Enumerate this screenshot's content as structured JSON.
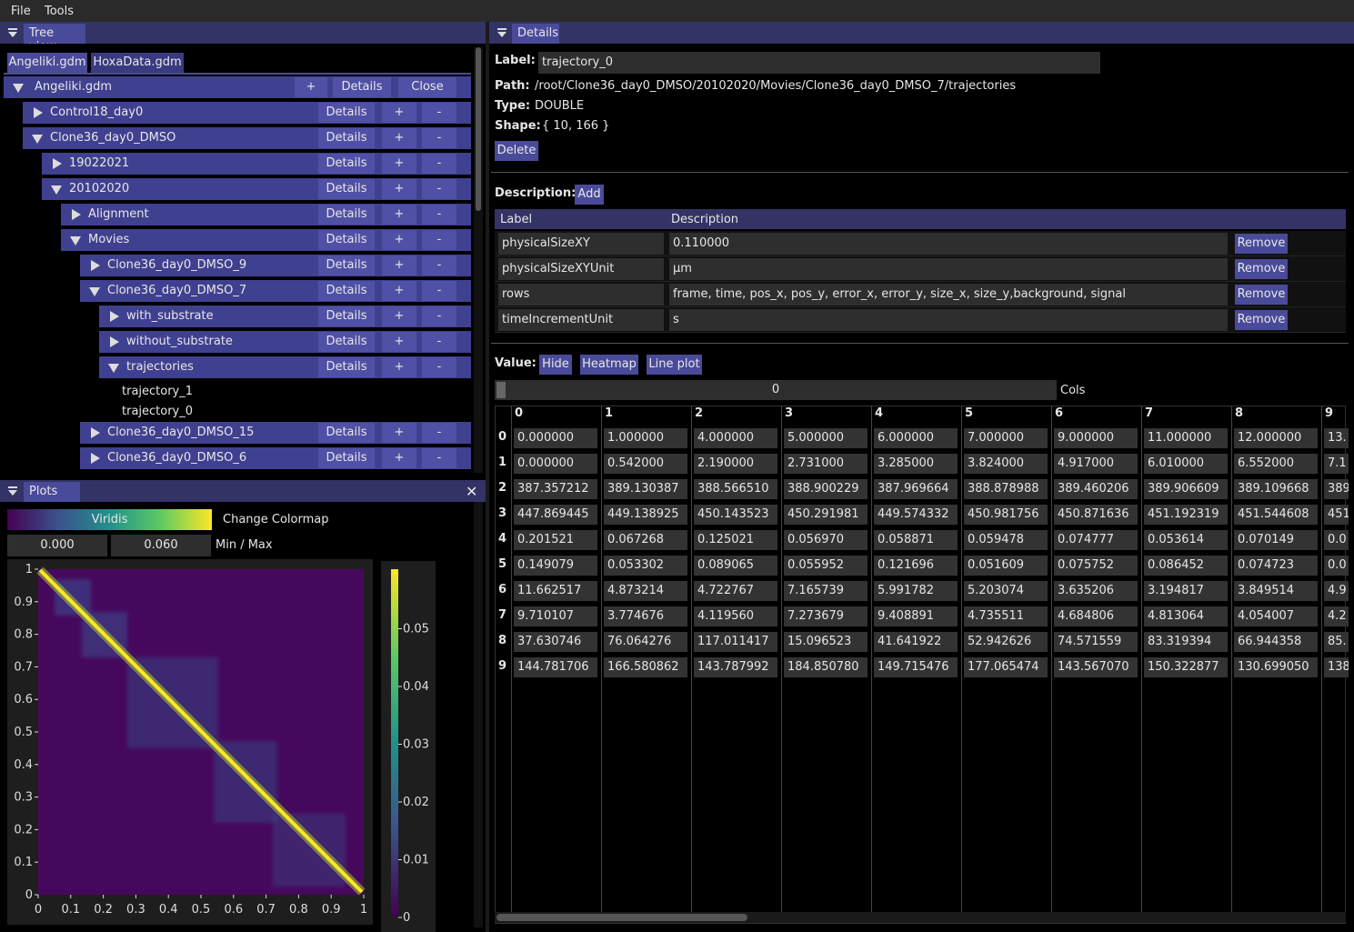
{
  "menu": {
    "file": "File",
    "tools": "Tools"
  },
  "tree_panel": {
    "title": "Tree view",
    "file_tabs": [
      "Angeliki.gdm",
      "HoxaData.gdm"
    ],
    "root": {
      "label": "Angeliki.gdm",
      "plus": "+",
      "details": "Details",
      "close": "Close"
    },
    "nodes": [
      {
        "label": "Control18_day0",
        "expanded": false
      },
      {
        "label": "Clone36_day0_DMSO",
        "expanded": true
      },
      {
        "label": "19022021",
        "expanded": false
      },
      {
        "label": "20102020",
        "expanded": true
      },
      {
        "label": "Alignment",
        "expanded": false
      },
      {
        "label": "Movies",
        "expanded": true
      },
      {
        "label": "Clone36_day0_DMSO_9",
        "expanded": false
      },
      {
        "label": "Clone36_day0_DMSO_7",
        "expanded": true
      },
      {
        "label": "with_substrate",
        "expanded": false
      },
      {
        "label": "without_substrate",
        "expanded": false
      },
      {
        "label": "trajectories",
        "expanded": true
      },
      {
        "label": "Clone36_day0_DMSO_15",
        "expanded": false
      },
      {
        "label": "Clone36_day0_DMSO_6",
        "expanded": false
      }
    ],
    "leaves": [
      "trajectory_1",
      "trajectory_0"
    ],
    "details_label": "Details",
    "plus_label": "+",
    "minus_label": "-"
  },
  "plots_panel": {
    "title": "Plots",
    "colormap_name": "Viridis",
    "change_colormap": "Change Colormap",
    "min_value": "0.000",
    "max_value": "0.060",
    "minmax_label": "Min / Max",
    "x_ticks": [
      "0",
      "0.1",
      "0.2",
      "0.3",
      "0.4",
      "0.5",
      "0.6",
      "0.7",
      "0.8",
      "0.9",
      "1"
    ],
    "y_ticks": [
      "0",
      "0.1",
      "0.2",
      "0.3",
      "0.4",
      "0.5",
      "0.6",
      "0.7",
      "0.8",
      "0.9",
      "1"
    ],
    "colorbar_ticks": [
      "0",
      "0.01",
      "0.02",
      "0.03",
      "0.04",
      "0.05"
    ]
  },
  "chart_data": {
    "type": "heatmap",
    "title": "",
    "xlim": [
      0,
      1
    ],
    "ylim": [
      0,
      1
    ],
    "colormap": "Viridis",
    "value_range": [
      0.0,
      0.06
    ],
    "colorbar_ticks": [
      0,
      0.01,
      0.02,
      0.03,
      0.04,
      0.05
    ]
  },
  "details_panel": {
    "title": "Details",
    "label_key": "Label:",
    "label_value": "trajectory_0",
    "path_key": "Path:",
    "path_value": "/root/Clone36_day0_DMSO/20102020/Movies/Clone36_day0_DMSO_7/trajectories",
    "type_key": "Type:",
    "type_value": "DOUBLE",
    "shape_key": "Shape:",
    "shape_value": "{ 10, 166 }",
    "delete": "Delete",
    "description_key": "Description:",
    "add": "Add",
    "desc_headers": [
      "Label",
      "Description"
    ],
    "descriptions": [
      {
        "label": "physicalSizeXY",
        "value": "0.110000"
      },
      {
        "label": "physicalSizeXYUnit",
        "value": "µm"
      },
      {
        "label": "rows",
        "value": "frame, time, pos_x, pos_y, error_x, error_y, size_x, size_y,background, signal"
      },
      {
        "label": "timeIncrementUnit",
        "value": "s"
      }
    ],
    "remove": "Remove",
    "value_key": "Value:",
    "hide": "Hide",
    "heatmap": "Heatmap",
    "line_plot": "Line plot",
    "cols_value": "0",
    "cols_label": "Cols",
    "col_headers": [
      "0",
      "1",
      "2",
      "3",
      "4",
      "5",
      "6",
      "7",
      "8",
      "9"
    ],
    "row_headers": [
      "0",
      "1",
      "2",
      "3",
      "4",
      "5",
      "6",
      "7",
      "8",
      "9"
    ],
    "table": [
      [
        "0.000000",
        "1.000000",
        "4.000000",
        "5.000000",
        "6.000000",
        "7.000000",
        "9.000000",
        "11.000000",
        "12.000000",
        "13."
      ],
      [
        "0.000000",
        "0.542000",
        "2.190000",
        "2.731000",
        "3.285000",
        "3.824000",
        "4.917000",
        "6.010000",
        "6.552000",
        "7.1"
      ],
      [
        "387.357212",
        "389.130387",
        "388.566510",
        "388.900229",
        "387.969664",
        "388.878988",
        "389.460206",
        "389.906609",
        "389.109668",
        "389"
      ],
      [
        "447.869445",
        "449.138925",
        "450.143523",
        "450.291981",
        "449.574332",
        "450.981756",
        "450.871636",
        "451.192319",
        "451.544608",
        "451"
      ],
      [
        "0.201521",
        "0.067268",
        "0.125021",
        "0.056970",
        "0.058871",
        "0.059478",
        "0.074777",
        "0.053614",
        "0.070149",
        "0.0"
      ],
      [
        "0.149079",
        "0.053302",
        "0.089065",
        "0.055952",
        "0.121696",
        "0.051609",
        "0.075752",
        "0.086452",
        "0.074723",
        "0.0"
      ],
      [
        "11.662517",
        "4.873214",
        "4.722767",
        "7.165739",
        "5.991782",
        "5.203074",
        "3.635206",
        "3.194817",
        "3.849514",
        "4.9"
      ],
      [
        "9.710107",
        "3.774676",
        "4.119560",
        "7.273679",
        "9.408891",
        "4.735511",
        "4.684806",
        "4.813064",
        "4.054007",
        "4.2"
      ],
      [
        "37.630746",
        "76.064276",
        "117.011417",
        "15.096523",
        "41.641922",
        "52.942626",
        "74.571559",
        "83.319394",
        "66.944358",
        "85."
      ],
      [
        "144.781706",
        "166.580862",
        "143.787992",
        "184.850780",
        "149.715476",
        "177.065474",
        "143.567070",
        "150.322877",
        "130.699050",
        "138"
      ]
    ]
  }
}
